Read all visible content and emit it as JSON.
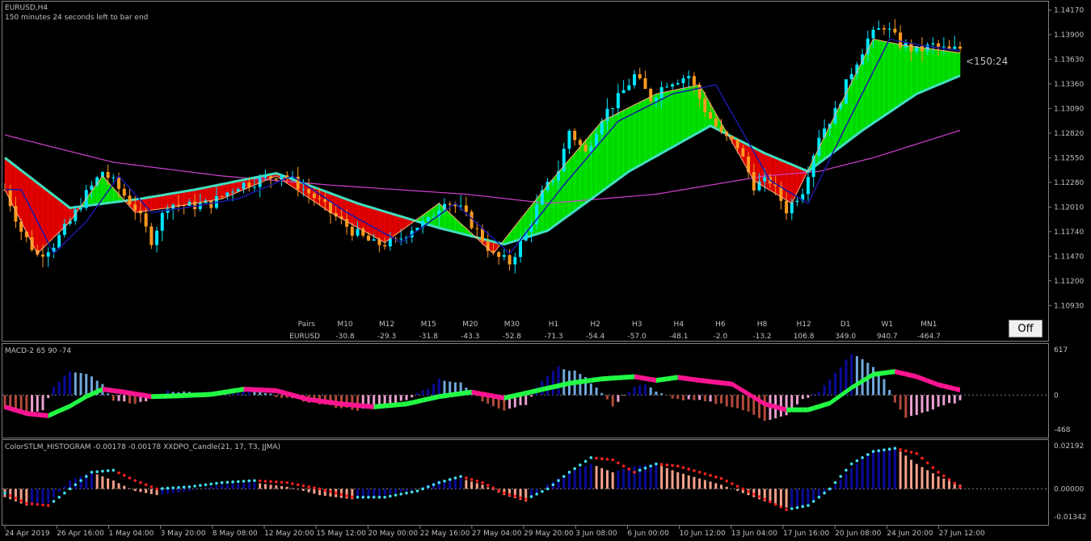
{
  "header": {
    "symbol_title": "EURUSD,H4",
    "bar_timer_text": "150 minutes 24 seconds left to bar end",
    "countdown_label": "<150:24"
  },
  "off_button_label": "Off",
  "colors": {
    "bull_candle": "#00e5ff",
    "bear_candle": "#ff9a1f",
    "ma_fast": "#ffb07a",
    "ma_dark": "#1a1aa8",
    "ribbon_edge": "#40e0c0",
    "ma_long": "#d040d0",
    "ribbon_bull": "#00ff00",
    "ribbon_bear": "#ff0000",
    "hist_blue": "#0b0b9a",
    "hist_lightblue": "#6fa8dc",
    "hist_pink": "#e9a0d0",
    "hist_brown": "#b04a3a",
    "macd_green": "#22ff44",
    "macd_pink": "#ff1493",
    "stlm_dot_cyan": "#40e0f0",
    "stlm_dot_red": "#ff2020",
    "stlm_salmon": "#f5a08a",
    "grid_text": "#c0c0c0",
    "positive": "#00cc00",
    "negative": "#ff3030"
  },
  "strength_table": {
    "row_label_header": "Pairs",
    "row_label": "EURUSD",
    "timeframes": [
      "M10",
      "M12",
      "M15",
      "M20",
      "M30",
      "H1",
      "H2",
      "H3",
      "H4",
      "H6",
      "H8",
      "H12",
      "D1",
      "W1",
      "MN1"
    ],
    "values": [
      "-30.8",
      "-29.3",
      "-31.8",
      "-43.3",
      "-52.8",
      "-71.3",
      "-54.4",
      "-57.0",
      "-48.1",
      "-2.0",
      "-13.2",
      "106.8",
      "349.0",
      "940.7",
      "-464.7"
    ]
  },
  "time_axis": [
    "24 Apr 2019",
    "26 Apr 16:00",
    "1 May 04:00",
    "3 May 20:00",
    "8 May 08:00",
    "12 May 20:00",
    "15 May 12:00",
    "20 May 00:00",
    "22 May 16:00",
    "27 May 04:00",
    "29 May 20:00",
    "3 Jun 08:00",
    "6 Jun 00:00",
    "10 Jun 12:00",
    "13 Jun 04:00",
    "17 Jun 16:00",
    "20 Jun 08:00",
    "24 Jun 20:00",
    "27 Jun 12:00"
  ],
  "chart_data": [
    {
      "type": "candlestick",
      "title": "EURUSD,H4",
      "ylim": [
        1.108,
        1.142
      ],
      "y_ticks": [
        "1.14170",
        "1.13900",
        "1.13630",
        "1.13360",
        "1.13090",
        "1.12820",
        "1.12550",
        "1.12280",
        "1.12010",
        "1.11740",
        "1.11470",
        "1.11200",
        "1.10930"
      ],
      "price_keypoints": [
        [
          0,
          1.122
        ],
        [
          3,
          1.1175
        ],
        [
          6,
          1.1148
        ],
        [
          9,
          1.116
        ],
        [
          12,
          1.1185
        ],
        [
          15,
          1.1215
        ],
        [
          18,
          1.124
        ],
        [
          20,
          1.1228
        ],
        [
          24,
          1.12
        ],
        [
          27,
          1.1165
        ],
        [
          30,
          1.1205
        ],
        [
          34,
          1.1202
        ],
        [
          38,
          1.1205
        ],
        [
          43,
          1.1225
        ],
        [
          47,
          1.123
        ],
        [
          51,
          1.1238
        ],
        [
          54,
          1.1225
        ],
        [
          57,
          1.1212
        ],
        [
          60,
          1.1195
        ],
        [
          64,
          1.1175
        ],
        [
          68,
          1.116
        ],
        [
          72,
          1.1162
        ],
        [
          75,
          1.1178
        ],
        [
          78,
          1.1185
        ],
        [
          81,
          1.121
        ],
        [
          84,
          1.1198
        ],
        [
          87,
          1.1175
        ],
        [
          90,
          1.1148
        ],
        [
          93,
          1.114
        ],
        [
          96,
          1.1172
        ],
        [
          99,
          1.1215
        ],
        [
          102,
          1.1242
        ],
        [
          104,
          1.1285
        ],
        [
          107,
          1.126
        ],
        [
          110,
          1.13
        ],
        [
          113,
          1.132
        ],
        [
          116,
          1.1345
        ],
        [
          119,
          1.132
        ],
        [
          122,
          1.1338
        ],
        [
          126,
          1.1345
        ],
        [
          129,
          1.1308
        ],
        [
          132,
          1.128
        ],
        [
          135,
          1.1268
        ],
        [
          138,
          1.1225
        ],
        [
          141,
          1.123
        ],
        [
          144,
          1.1198
        ],
        [
          147,
          1.122
        ],
        [
          150,
          1.128
        ],
        [
          153,
          1.1305
        ],
        [
          156,
          1.135
        ],
        [
          159,
          1.1385
        ],
        [
          162,
          1.14
        ],
        [
          165,
          1.138
        ],
        [
          168,
          1.1372
        ],
        [
          171,
          1.1378
        ],
        [
          174,
          1.1372
        ],
        [
          176,
          1.1375
        ]
      ],
      "series": [
        {
          "name": "ribbon_slow",
          "values": [
            [
              0,
              1.1255
            ],
            [
              12,
              1.12
            ],
            [
              25,
              1.121
            ],
            [
              35,
              1.122
            ],
            [
              50,
              1.1238
            ],
            [
              65,
              1.1205
            ],
            [
              80,
              1.1178
            ],
            [
              92,
              1.116
            ],
            [
              100,
              1.1175
            ],
            [
              115,
              1.124
            ],
            [
              130,
              1.129
            ],
            [
              140,
              1.126
            ],
            [
              148,
              1.124
            ],
            [
              158,
              1.1285
            ],
            [
              168,
              1.1325
            ],
            [
              176,
              1.1345
            ]
          ]
        },
        {
          "name": "ribbon_fast",
          "values": [
            [
              0,
              1.122
            ],
            [
              6,
              1.115
            ],
            [
              12,
              1.1185
            ],
            [
              18,
              1.1235
            ],
            [
              24,
              1.1195
            ],
            [
              30,
              1.12
            ],
            [
              40,
              1.121
            ],
            [
              50,
              1.1235
            ],
            [
              60,
              1.1195
            ],
            [
              70,
              1.1162
            ],
            [
              80,
              1.1205
            ],
            [
              90,
              1.115
            ],
            [
              100,
              1.1225
            ],
            [
              110,
              1.1295
            ],
            [
              120,
              1.1325
            ],
            [
              128,
              1.1335
            ],
            [
              138,
              1.123
            ],
            [
              145,
              1.1205
            ],
            [
              152,
              1.129
            ],
            [
              160,
              1.1385
            ],
            [
              166,
              1.1378
            ],
            [
              176,
              1.137
            ]
          ]
        },
        {
          "name": "ma_long",
          "values": [
            [
              0,
              1.128
            ],
            [
              20,
              1.125
            ],
            [
              40,
              1.1235
            ],
            [
              60,
              1.1225
            ],
            [
              85,
              1.1215
            ],
            [
              100,
              1.1205
            ],
            [
              120,
              1.1215
            ],
            [
              140,
              1.1235
            ],
            [
              150,
              1.124
            ],
            [
              160,
              1.1255
            ],
            [
              176,
              1.1285
            ]
          ]
        }
      ]
    },
    {
      "type": "histogram",
      "title": "MACD-2 65 90 -74",
      "y_ticks": [
        "617",
        "0",
        "-468"
      ],
      "ylim": [
        -468,
        617
      ],
      "histogram": [
        [
          0,
          -180
        ],
        [
          4,
          -240
        ],
        [
          7,
          -200
        ],
        [
          9,
          120
        ],
        [
          12,
          330
        ],
        [
          15,
          300
        ],
        [
          18,
          150
        ],
        [
          20,
          -80
        ],
        [
          24,
          -120
        ],
        [
          27,
          -50
        ],
        [
          30,
          60
        ],
        [
          34,
          40
        ],
        [
          38,
          20
        ],
        [
          42,
          60
        ],
        [
          45,
          80
        ],
        [
          48,
          20
        ],
        [
          52,
          -40
        ],
        [
          56,
          -90
        ],
        [
          60,
          -150
        ],
        [
          65,
          -200
        ],
        [
          70,
          -160
        ],
        [
          74,
          -60
        ],
        [
          78,
          100
        ],
        [
          80,
          220
        ],
        [
          84,
          160
        ],
        [
          88,
          -80
        ],
        [
          92,
          -200
        ],
        [
          96,
          -120
        ],
        [
          99,
          200
        ],
        [
          102,
          380
        ],
        [
          106,
          300
        ],
        [
          110,
          40
        ],
        [
          112,
          -160
        ],
        [
          116,
          120
        ],
        [
          118,
          150
        ],
        [
          120,
          40
        ],
        [
          124,
          -60
        ],
        [
          128,
          -80
        ],
        [
          132,
          -120
        ],
        [
          136,
          -200
        ],
        [
          140,
          -340
        ],
        [
          144,
          -280
        ],
        [
          147,
          -60
        ],
        [
          150,
          40
        ],
        [
          153,
          300
        ],
        [
          156,
          560
        ],
        [
          159,
          450
        ],
        [
          162,
          220
        ],
        [
          164,
          -100
        ],
        [
          166,
          -300
        ],
        [
          170,
          -220
        ],
        [
          174,
          -120
        ],
        [
          176,
          -80
        ]
      ],
      "signal": [
        [
          0,
          -160
        ],
        [
          4,
          -250
        ],
        [
          8,
          -280
        ],
        [
          12,
          -150
        ],
        [
          15,
          -20
        ],
        [
          18,
          80
        ],
        [
          22,
          40
        ],
        [
          27,
          -20
        ],
        [
          32,
          -10
        ],
        [
          38,
          10
        ],
        [
          44,
          80
        ],
        [
          50,
          60
        ],
        [
          56,
          -60
        ],
        [
          62,
          -120
        ],
        [
          68,
          -160
        ],
        [
          74,
          -120
        ],
        [
          80,
          -20
        ],
        [
          86,
          40
        ],
        [
          92,
          -40
        ],
        [
          98,
          60
        ],
        [
          104,
          160
        ],
        [
          110,
          220
        ],
        [
          116,
          250
        ],
        [
          120,
          200
        ],
        [
          124,
          240
        ],
        [
          128,
          200
        ],
        [
          134,
          150
        ],
        [
          140,
          -120
        ],
        [
          144,
          -200
        ],
        [
          148,
          -200
        ],
        [
          152,
          -110
        ],
        [
          156,
          100
        ],
        [
          160,
          280
        ],
        [
          164,
          320
        ],
        [
          168,
          250
        ],
        [
          172,
          140
        ],
        [
          176,
          70
        ]
      ]
    },
    {
      "type": "histogram",
      "title": "ColorSTLM_HISTOGRAM -0.00178 -0.00178 XXDPO_Candle(21, 17, T3, JJMA)",
      "y_ticks": [
        "0.02192",
        "0.00000",
        "-0.01342"
      ],
      "ylim": [
        -0.01342,
        0.02192
      ],
      "histogram": [
        [
          0,
          -0.004
        ],
        [
          4,
          -0.008
        ],
        [
          8,
          -0.007
        ],
        [
          12,
          0.004
        ],
        [
          16,
          0.008
        ],
        [
          20,
          0.004
        ],
        [
          24,
          -0.001
        ],
        [
          28,
          -0.003
        ],
        [
          34,
          -0.001
        ],
        [
          40,
          0.002
        ],
        [
          46,
          0.003
        ],
        [
          52,
          0.001
        ],
        [
          58,
          -0.003
        ],
        [
          64,
          -0.005
        ],
        [
          70,
          -0.003
        ],
        [
          76,
          0.0
        ],
        [
          80,
          0.004
        ],
        [
          84,
          0.005
        ],
        [
          88,
          0.002
        ],
        [
          92,
          -0.003
        ],
        [
          96,
          -0.006
        ],
        [
          100,
          0.002
        ],
        [
          104,
          0.008
        ],
        [
          108,
          0.012
        ],
        [
          112,
          0.008
        ],
        [
          116,
          0.011
        ],
        [
          120,
          0.012
        ],
        [
          124,
          0.008
        ],
        [
          128,
          0.005
        ],
        [
          132,
          0.002
        ],
        [
          136,
          -0.002
        ],
        [
          140,
          -0.006
        ],
        [
          144,
          -0.009
        ],
        [
          148,
          -0.008
        ],
        [
          152,
          -0.001
        ],
        [
          156,
          0.01
        ],
        [
          160,
          0.018
        ],
        [
          164,
          0.02
        ],
        [
          168,
          0.012
        ],
        [
          172,
          0.006
        ],
        [
          176,
          0.002
        ]
      ],
      "line": [
        [
          0,
          -0.002
        ],
        [
          4,
          -0.007
        ],
        [
          8,
          -0.008
        ],
        [
          12,
          0.0
        ],
        [
          16,
          0.008
        ],
        [
          20,
          0.009
        ],
        [
          24,
          0.004
        ],
        [
          28,
          0.0
        ],
        [
          34,
          0.001
        ],
        [
          40,
          0.003
        ],
        [
          46,
          0.004
        ],
        [
          52,
          0.003
        ],
        [
          58,
          0.0
        ],
        [
          64,
          -0.004
        ],
        [
          70,
          -0.004
        ],
        [
          76,
          -0.001
        ],
        [
          80,
          0.003
        ],
        [
          84,
          0.006
        ],
        [
          88,
          0.003
        ],
        [
          92,
          -0.002
        ],
        [
          96,
          -0.005
        ],
        [
          100,
          0.0
        ],
        [
          104,
          0.008
        ],
        [
          108,
          0.015
        ],
        [
          112,
          0.014
        ],
        [
          116,
          0.008
        ],
        [
          120,
          0.012
        ],
        [
          124,
          0.011
        ],
        [
          128,
          0.008
        ],
        [
          132,
          0.005
        ],
        [
          136,
          0.0
        ],
        [
          140,
          -0.005
        ],
        [
          144,
          -0.01
        ],
        [
          148,
          -0.008
        ],
        [
          152,
          0.0
        ],
        [
          156,
          0.012
        ],
        [
          160,
          0.018
        ],
        [
          164,
          0.0195
        ],
        [
          168,
          0.017
        ],
        [
          172,
          0.008
        ],
        [
          176,
          0.001
        ]
      ]
    }
  ]
}
